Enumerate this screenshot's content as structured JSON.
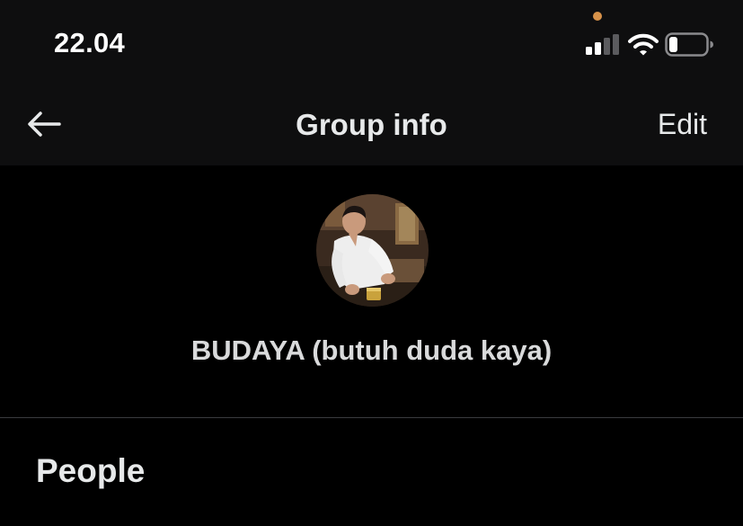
{
  "status_bar": {
    "time": "22.04",
    "icons": [
      "signal-icon",
      "wifi-icon",
      "battery-icon"
    ],
    "privacy_indicator_color": "#d7924a"
  },
  "header": {
    "back_icon": "arrow-left-icon",
    "title": "Group info",
    "edit_label": "Edit"
  },
  "group": {
    "avatar_icon": "group-avatar",
    "name": "BUDAYA (butuh duda kaya)"
  },
  "sections": {
    "people_heading": "People"
  },
  "colors": {
    "background": "#000000",
    "bar_background": "#0e0e0f",
    "text_primary": "#e7e9ea",
    "divider": "#3a3b3e"
  }
}
